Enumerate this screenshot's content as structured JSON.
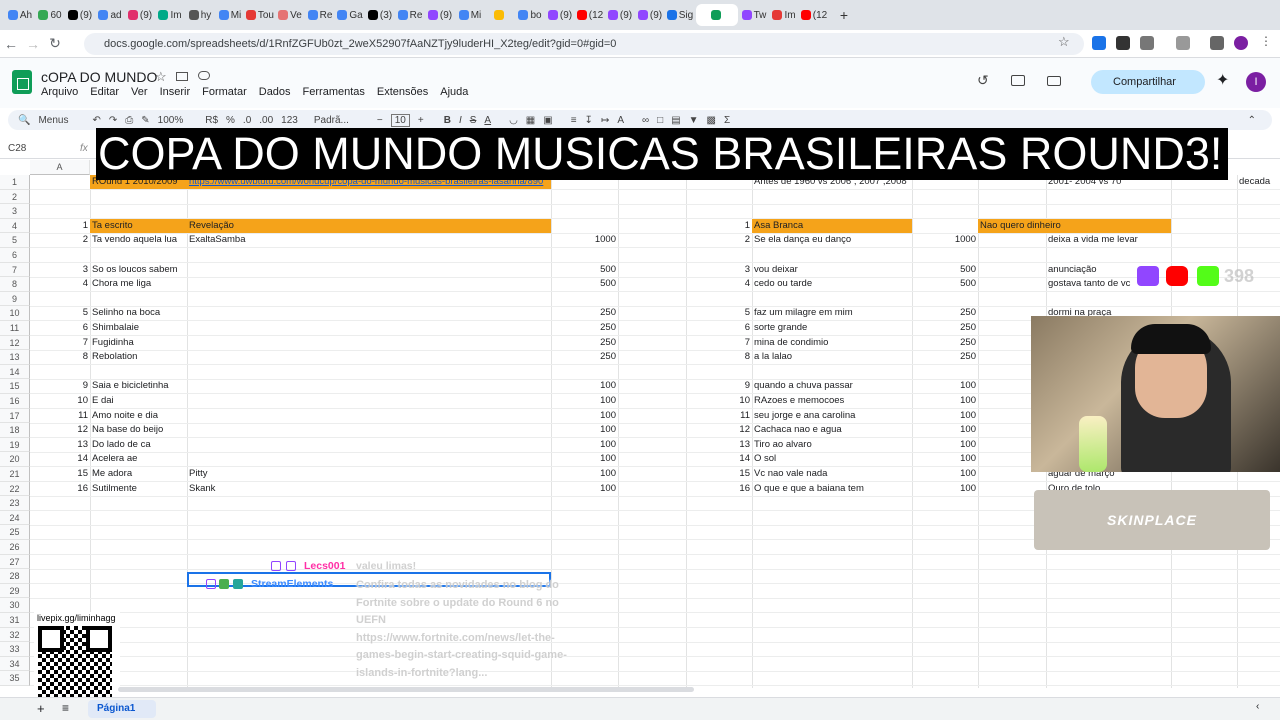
{
  "browser": {
    "tabs": [
      "Ah",
      "60",
      "(9)",
      "ad",
      "(9)",
      "Im",
      "hy",
      "Mi",
      "Tou",
      "Ve",
      "Re",
      "Ga",
      "(3)",
      "Re",
      "(9)",
      "Mi",
      "",
      "bo",
      "(9)",
      "(12",
      "(9)",
      "(9)",
      "Sig",
      "",
      "Tw",
      "Im",
      "(12"
    ],
    "url": "docs.google.com/spreadsheets/d/1RnfZGFUb0zt_2weX52907fAaNZTjy9luderHI_X2teg/edit?gid=0#gid=0"
  },
  "sheets": {
    "title": "cOPA DO MUNDO",
    "menus": [
      "Arquivo",
      "Editar",
      "Ver",
      "Inserir",
      "Formatar",
      "Dados",
      "Ferramentas",
      "Extensões",
      "Ajuda"
    ],
    "share": "Compartilhar",
    "avatar": "I",
    "toolbar": {
      "menus": "Menus",
      "zoom": "100%",
      "currency": "R$",
      "percent": "%",
      "dec1": ".0",
      "dec2": ".00",
      "num": "123",
      "font": "Padrã...",
      "size": "10"
    },
    "namebox": "C28",
    "fx": "fx",
    "sheet_tab": "Página1"
  },
  "banner": "COPA DO MUNDO MUSICAS BRASILEIRAS ROUND3!",
  "grid": {
    "col_a": "A",
    "rows": [
      "1",
      "2",
      "3",
      "4",
      "5",
      "6",
      "7",
      "8",
      "9",
      "10",
      "11",
      "12",
      "13",
      "14",
      "15",
      "16",
      "17",
      "18",
      "19",
      "20",
      "21",
      "22",
      "23",
      "24",
      "25",
      "26",
      "27",
      "28",
      "29",
      "30",
      "31",
      "32",
      "33",
      "34",
      "35"
    ],
    "r1_b": "ROund 1 2010/2009",
    "r1_c": "https://www.uwbtutu.com/worldcup/copa-do-mundo-musicas-brasileiras-lasanha/890",
    "r1_g": "Antes de 1960 vs 2006 , 2007 ,2008",
    "r1_j": "2001- 2004 vs 70",
    "r1_k": "decada",
    "left_header": {
      "num": "1",
      "b": "Ta escrito",
      "c": "Revelação"
    },
    "left": [
      {
        "num": "2",
        "b": "Ta vendo aquela lua",
        "c": "ExaltaSamba",
        "d": "1000"
      },
      {
        "num": "3",
        "b": "So os loucos sabem",
        "c": "",
        "d": "500"
      },
      {
        "num": "4",
        "b": "Chora me liga",
        "c": "",
        "d": "500"
      },
      {
        "num": "5",
        "b": "Selinho na boca",
        "c": "",
        "d": "250"
      },
      {
        "num": "6",
        "b": "Shimbalaie",
        "c": "",
        "d": "250"
      },
      {
        "num": "7",
        "b": "Fugidinha",
        "c": "",
        "d": "250"
      },
      {
        "num": "8",
        "b": "Rebolation",
        "c": "",
        "d": "250"
      },
      {
        "num": "9",
        "b": "Saia e bicicletinha",
        "c": "",
        "d": "100"
      },
      {
        "num": "10",
        "b": "E dai",
        "c": "",
        "d": "100"
      },
      {
        "num": "11",
        "b": "Amo noite e dia",
        "c": "",
        "d": "100"
      },
      {
        "num": "12",
        "b": "Na base do beijo",
        "c": "",
        "d": "100"
      },
      {
        "num": "13",
        "b": "Do lado de ca",
        "c": "",
        "d": "100"
      },
      {
        "num": "14",
        "b": "Acelera ae",
        "c": "",
        "d": "100"
      },
      {
        "num": "15",
        "b": "Me adora",
        "c": "Pitty",
        "d": "100"
      },
      {
        "num": "16",
        "b": "Sutilmente",
        "c": "Skank",
        "d": "100"
      }
    ],
    "right_header": {
      "num": "1",
      "g": "Asa Branca",
      "j": "Nao quero dinheiro"
    },
    "right": [
      {
        "num": "2",
        "g": "Se ela dança eu danço",
        "h": "1000",
        "j": "deixa a vida me levar"
      },
      {
        "num": "3",
        "g": "vou deixar",
        "h": "500",
        "j": "anunciação"
      },
      {
        "num": "4",
        "g": "cedo ou tarde",
        "h": "500",
        "j": "gostava tanto de vc"
      },
      {
        "num": "5",
        "g": "faz um milagre em mim",
        "h": "250",
        "j": "dormi na praça"
      },
      {
        "num": "6",
        "g": "sorte grande",
        "h": "250",
        "j": ""
      },
      {
        "num": "7",
        "g": "mina de condimio",
        "h": "250",
        "j": ""
      },
      {
        "num": "8",
        "g": "a la lalao",
        "h": "250",
        "j": ""
      },
      {
        "num": "9",
        "g": "quando a chuva passar",
        "h": "100",
        "j": ""
      },
      {
        "num": "10",
        "g": "RAzoes e memocoes",
        "h": "100",
        "j": ""
      },
      {
        "num": "11",
        "g": "seu jorge  e ana carolina",
        "h": "100",
        "j": ""
      },
      {
        "num": "12",
        "g": "Cachaca nao e agua",
        "h": "100",
        "j": ""
      },
      {
        "num": "13",
        "g": "Tiro ao alvaro",
        "h": "100",
        "j": ""
      },
      {
        "num": "14",
        "g": "O sol",
        "h": "100",
        "j": ""
      },
      {
        "num": "15",
        "g": "Vc nao vale nada",
        "h": "100",
        "j": "aguar de março"
      },
      {
        "num": "16",
        "g": "O que e que a baiana tem",
        "h": "100",
        "j": "Ouro de tolo"
      }
    ]
  },
  "overlay": {
    "chat1_user": "Lecs001",
    "chat1_msg": "valeu limas!",
    "chat2_user": "StreamElements",
    "chat2_lines": [
      "Confira todas as novidades no blog do",
      "Fortnite sobre o update do Round 6 no",
      "UEFN",
      "https://www.fortnite.com/news/let-the-",
      "games-begin-start-creating-squid-game-",
      "islands-in-fortnite?lang..."
    ],
    "skinplace": "SKINPLACE",
    "qr_label": "livepix.gg/liminhagg",
    "follower_count": "398",
    "colors": {
      "twitch": "#9146ff",
      "youtube": "#ff0000",
      "kick": "#53fc18",
      "orange": "#f5a31a"
    }
  }
}
